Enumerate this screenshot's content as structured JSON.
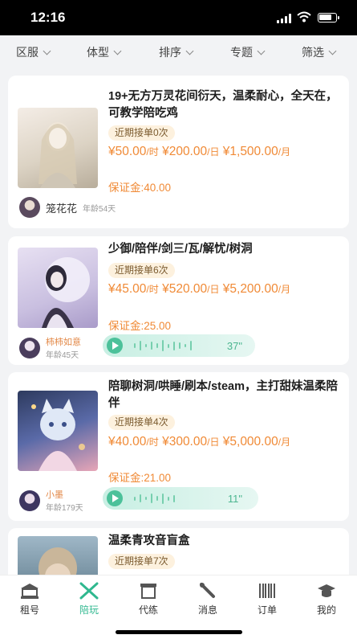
{
  "status": {
    "time": "12:16"
  },
  "filters": [
    "区服",
    "体型",
    "排序",
    "专题",
    "筛选"
  ],
  "cards": [
    {
      "title": "19+无方万灵花间衍天，温柔耐心，全天在，可教学陪吃鸡",
      "tag": "近期接单0次",
      "price_hour": "¥50.00",
      "unit_hour": "/时",
      "price_day": "¥200.00",
      "unit_day": "/日",
      "price_month": "¥1,500.00",
      "unit_month": "/月",
      "deposit": "保证金:40.00",
      "owner_name": "笼花花",
      "owner_age": "年龄54天"
    },
    {
      "title": "少御/陪伴/剑三/瓦/解忧/树洞",
      "tag": "近期接单6次",
      "price_hour": "¥45.00",
      "unit_hour": "/时",
      "price_day": "¥520.00",
      "unit_day": "/日",
      "price_month": "¥5,200.00",
      "unit_month": "/月",
      "deposit": "保证金:25.00",
      "owner_name": "柿柿如意",
      "owner_age": "年龄45天",
      "voice_duration": "37\""
    },
    {
      "title": "陪聊树洞/哄睡/刷本/steam，主打甜妹温柔陪伴",
      "tag": "近期接单4次",
      "price_hour": "¥40.00",
      "unit_hour": "/时",
      "price_day": "¥300.00",
      "unit_day": "/日",
      "price_month": "¥5,000.00",
      "unit_month": "/月",
      "deposit": "保证金:21.00",
      "owner_name": "小墨",
      "owner_age": "年龄179天",
      "voice_duration": "11\""
    },
    {
      "title": "温柔青攻音盲盒",
      "tag": "近期接单7次"
    }
  ],
  "tabs": [
    "租号",
    "陪玩",
    "代练",
    "消息",
    "订单",
    "我的"
  ],
  "colors": {
    "accent": "#2fb88f",
    "price": "#f08a36",
    "tag_bg": "#fdf1de"
  }
}
